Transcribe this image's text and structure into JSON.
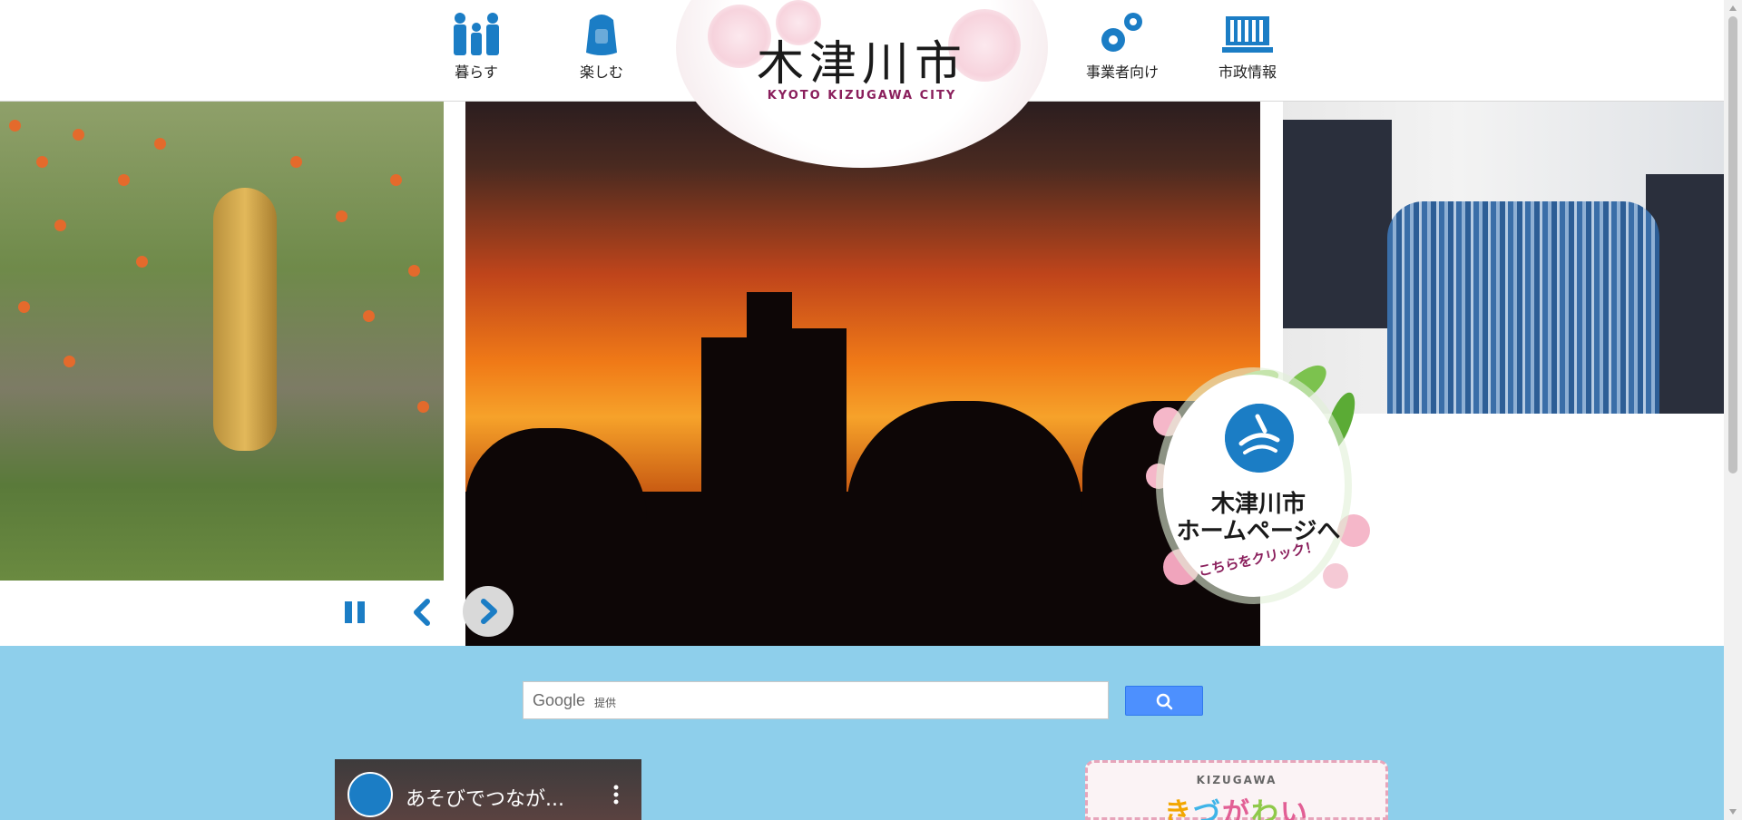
{
  "nav": {
    "items": [
      {
        "label": "暮らす",
        "icon": "family-icon"
      },
      {
        "label": "楽しむ",
        "icon": "backpack-icon"
      },
      {
        "label": "事業者向け",
        "icon": "gears-icon"
      },
      {
        "label": "市政情報",
        "icon": "city-building-icon"
      }
    ]
  },
  "logo": {
    "title": "木津川市",
    "subtitle": "KYOTO KIZUGAWA CITY"
  },
  "homepage_badge": {
    "line1": "木津川市",
    "line2": "ホームページへ",
    "click_text": "こちらをクリック！"
  },
  "search": {
    "brand": "Google",
    "provided": "提供",
    "button_icon": "search-icon"
  },
  "video": {
    "title": "あそびでつなが..."
  },
  "banner": {
    "small_text": "KIZUGAWA",
    "big_text": [
      "き",
      "づ",
      "が",
      "わ",
      "い"
    ]
  },
  "colors": {
    "accent_blue": "#1b7dc5",
    "section_blue": "#8ecfeb",
    "logo_magenta": "#8a1f5c",
    "search_button": "#4d90fe"
  }
}
